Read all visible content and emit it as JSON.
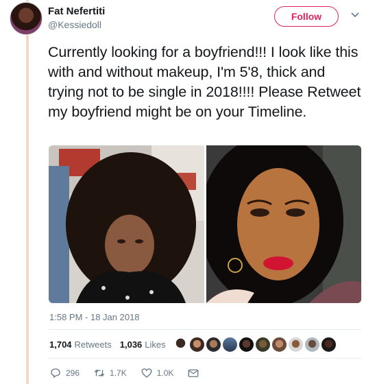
{
  "tweet": {
    "author_name": "Fat Nefertiti",
    "author_handle": "@Kessiedoll",
    "follow_label": "Follow",
    "text": "Currently looking for a boyfriend!!! I look like this with and without makeup, I'm 5'8, thick and trying not to be single in 2018!!!! Please Retweet my boyfriend might be on your Timeline.",
    "timestamp": "1:58 PM - 18 Jan 2018"
  },
  "stats": {
    "retweets_count": "1,704",
    "retweets_label": "Retweets",
    "likes_count": "1,036",
    "likes_label": "Likes",
    "liker_avatar_count": 10
  },
  "actions": {
    "reply_count": "296",
    "retweet_count": "1.7K",
    "like_count": "1.0K"
  },
  "colors": {
    "follow_accent": "#e0245e",
    "secondary_text": "#657786",
    "thread_line": "#f4d8c6"
  }
}
